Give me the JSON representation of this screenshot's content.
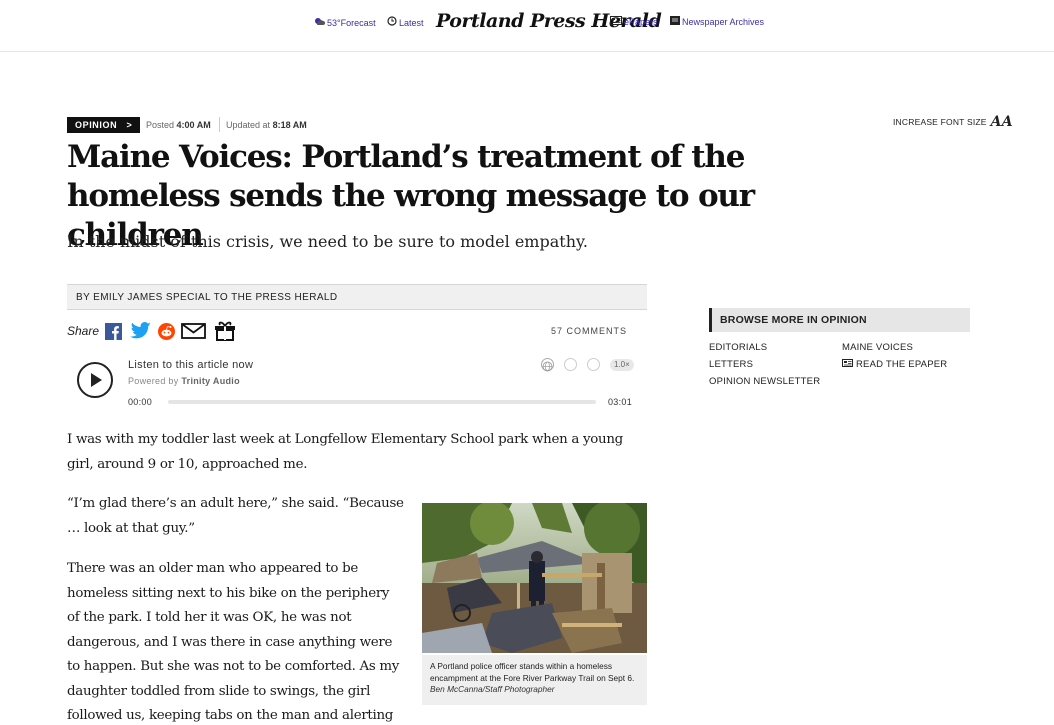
{
  "nav": {
    "forecast": "53°Forecast",
    "latest": "Latest",
    "logo": "Portland Press Herald",
    "epapers": "ePapers",
    "archives": "Newspaper Archives"
  },
  "article": {
    "section_tag": "OPINION",
    "section_arrow": ">",
    "posted_label": "Posted",
    "posted_time": "4:00 AM",
    "updated_label": "Updated at",
    "updated_time": "8:18 AM",
    "font_size_label": "INCREASE FONT SIZE",
    "font_size_glyph": "AA",
    "title": "Maine Voices: Portland’s treatment of the homeless sends the wrong message to our children",
    "subtitle": "In the midst of this crisis, we need to be sure to model empathy.",
    "byline": "BY EMILY JAMES SPECIAL TO THE PRESS HERALD",
    "share_label": "Share",
    "comments": "57 COMMENTS",
    "paragraphs": [
      "I was with my toddler last week at Longfellow Elementary School park when a young girl, around 9 or 10, approached me.",
      "“I’m glad there’s an adult here,” she said. “Because … look at that guy.”",
      "There was an older man who appeared to be homeless sitting next to his bike on the periphery of the park. I told her it was OK, he was not dangerous, and I was there in case anything were to happen. But she was not to be comforted. As my daughter toddled from slide to swings, the girl followed us, keeping tabs on the man and alerting me to his every move."
    ]
  },
  "audio": {
    "listen": "Listen to this article now",
    "powered_prefix": "Powered by",
    "powered_brand": "Trinity Audio",
    "time_start": "00:00",
    "time_end": "03:01",
    "speed": "1.0×",
    "progress": 0
  },
  "photo": {
    "caption": "A Portland police officer stands within a homeless encampment at the Fore River Parkway Trail on Sept 6.",
    "credit": "Ben McCanna/Staff Photographer"
  },
  "sidebar": {
    "heading": "BROWSE MORE IN OPINION",
    "links_left": [
      "EDITORIALS",
      "LETTERS",
      "OPINION NEWSLETTER"
    ],
    "links_right": [
      "MAINE VOICES",
      "READ THE EPAPER"
    ]
  },
  "colors": {
    "nav_link": "#3b2fa8",
    "tag_bg": "#111111",
    "byline_bg": "#f0f0f0",
    "caption_bg": "#efefef",
    "facebook": "#3b5998",
    "twitter": "#1da1f2",
    "reddit": "#ff4500"
  }
}
